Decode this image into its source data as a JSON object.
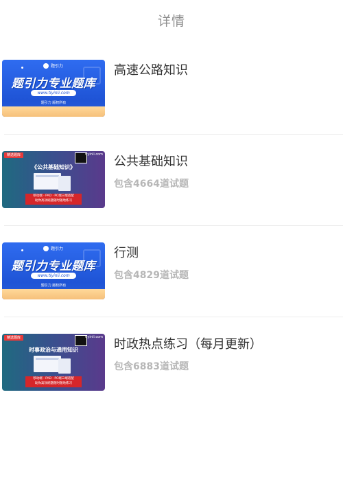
{
  "header": {
    "title": "详情"
  },
  "items": [
    {
      "title": "高速公路知识",
      "count": "",
      "thumb_style": "blue"
    },
    {
      "title": "公共基础知识",
      "count": "包含4664道试题",
      "thumb_style": "purple"
    },
    {
      "title": "行测",
      "count": "包含4829道试题",
      "thumb_style": "blue"
    },
    {
      "title": "时政热点练习（每月更新）",
      "count": "包含6883道试题",
      "thumb_style": "purple"
    }
  ],
  "thumb_blue": {
    "logo_text": "题引力",
    "main_text": "题引力专业题库",
    "url": "www.tiyinli.com",
    "rights": "题引力 版权所有"
  },
  "thumb_purple_1": {
    "tag": "精选题库",
    "brand": "tiyinli.com",
    "heading": "《公共基础知识》",
    "redbox_line1": "移动端 · PAD · PC端三端适配",
    "redbox_line2": "助你高效刷题随时随地练习"
  },
  "thumb_purple_2": {
    "tag": "精选题库",
    "brand": "tiyinli.com",
    "heading": "时事政治与通用知识",
    "redbox_line1": "移动端 · PAD · PC端三端适配",
    "redbox_line2": "助你高效刷题随时随地练习"
  },
  "colors": {
    "title": "#333333",
    "count": "#b7b7b7",
    "header": "#8f8f8f",
    "divider": "#ececec"
  }
}
